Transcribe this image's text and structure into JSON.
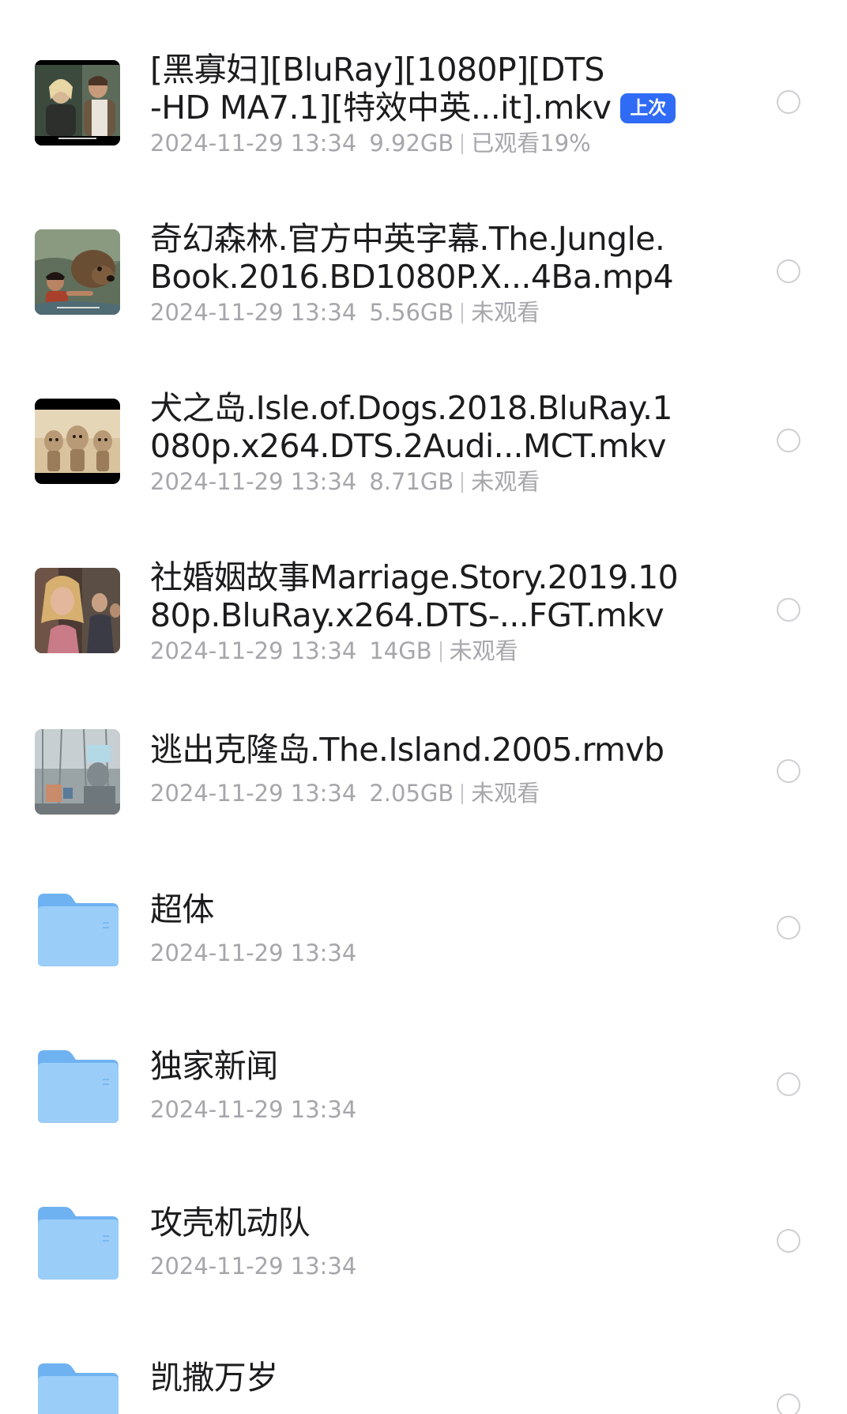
{
  "items": [
    {
      "kind": "video",
      "title_line1": "[黑寡妇][BluRay][1080P][DTS",
      "title_line2": "-HD MA7.1][特效中英...it].mkv",
      "badge": "上次",
      "date": "2024-11-29 13:34",
      "size": "9.92GB",
      "status": "已观看19%",
      "thumbnail": "movie-poster-black-widow"
    },
    {
      "kind": "video",
      "title_line1": "奇幻森林.官方中英字幕.The.Jungle.",
      "title_line2": "Book.2016.BD1080P.X...4Ba.mp4",
      "date": "2024-11-29 13:34",
      "size": "5.56GB",
      "status": "未观看",
      "thumbnail": "movie-still-jungle-book"
    },
    {
      "kind": "video",
      "title_line1": "犬之岛.Isle.of.Dogs.2018.BluRay.1",
      "title_line2": "080p.x264.DTS.2Audi...MCT.mkv",
      "date": "2024-11-29 13:34",
      "size": "8.71GB",
      "status": "未观看",
      "thumbnail": "movie-still-isle-of-dogs"
    },
    {
      "kind": "video",
      "title_line1": "社婚姻故事Marriage.Story.2019.10",
      "title_line2": "80p.BluRay.x264.DTS-...FGT.mkv",
      "date": "2024-11-29 13:34",
      "size": "14GB",
      "status": "未观看",
      "thumbnail": "movie-still-marriage-story"
    },
    {
      "kind": "video",
      "title_line1": "逃出克隆岛.The.Island.2005.rmvb",
      "title_line2": "",
      "date": "2024-11-29 13:34",
      "size": "2.05GB",
      "status": "未观看",
      "thumbnail": "movie-still-the-island"
    },
    {
      "kind": "folder",
      "title_line1": "超体",
      "date": "2024-11-29 13:34",
      "icon": "folder-icon"
    },
    {
      "kind": "folder",
      "title_line1": "独家新闻",
      "date": "2024-11-29 13:34",
      "icon": "folder-icon"
    },
    {
      "kind": "folder",
      "title_line1": "攻壳机动队",
      "date": "2024-11-29 13:34",
      "icon": "folder-icon"
    },
    {
      "kind": "folder",
      "title_line1": "凯撒万岁",
      "date": "",
      "icon": "folder-icon"
    }
  ],
  "colors": {
    "title": "#1c1c1e",
    "meta": "#a6a6ab",
    "badge_bg": "#2f6bf5",
    "folder": "#8ec5f7",
    "radio_border": "#cfcfd3"
  }
}
